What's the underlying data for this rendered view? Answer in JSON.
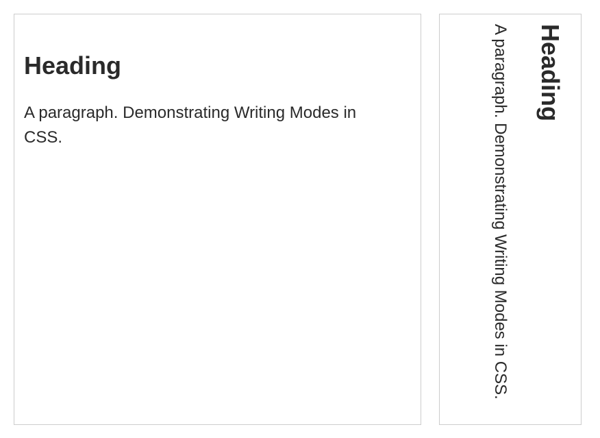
{
  "horizontal_box": {
    "heading": "Heading",
    "paragraph": "A paragraph. Demonstrating Writing Modes in CSS."
  },
  "vertical_box": {
    "heading": "Heading",
    "paragraph": "A paragraph. Demonstrating Writing Modes in CSS."
  }
}
